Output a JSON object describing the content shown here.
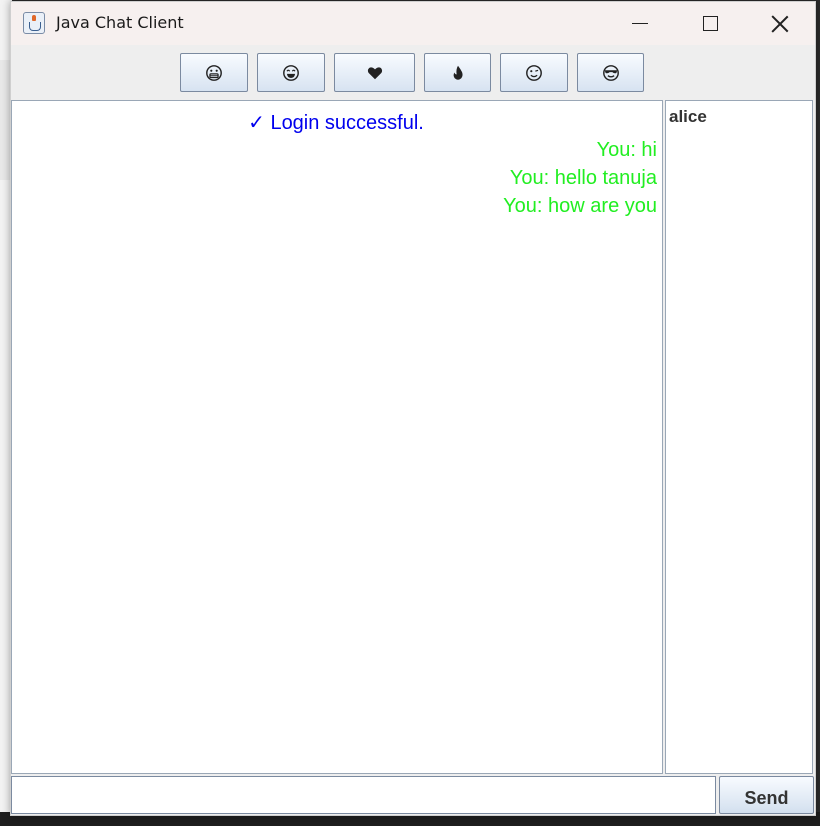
{
  "window": {
    "title": "Java Chat Client"
  },
  "toolbar": {
    "emojis": [
      {
        "icon": "grinning-face-icon"
      },
      {
        "icon": "laughing-face-icon"
      },
      {
        "icon": "heart-icon"
      },
      {
        "icon": "fire-icon"
      },
      {
        "icon": "winking-face-icon"
      },
      {
        "icon": "sunglasses-face-icon"
      }
    ]
  },
  "chat": {
    "system_message": "✓ Login successful.",
    "messages": [
      "You: hi",
      "You: hello tanuja",
      "You: how are you"
    ],
    "colors": {
      "system": "#0000ee",
      "self": "#22ee22"
    }
  },
  "users": {
    "list": [
      "alice"
    ]
  },
  "composer": {
    "input_value": "",
    "send_label": "Send"
  }
}
